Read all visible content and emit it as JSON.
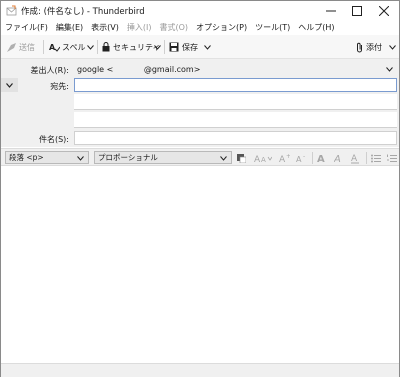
{
  "window": {
    "title": "作成: (件名なし) - Thunderbird"
  },
  "menubar": {
    "items": [
      "ファイル(F)",
      "編集(E)",
      "表示(V)",
      "挿入(I)",
      "書式(O)",
      "オプション(P)",
      "ツール(T)",
      "ヘルプ(H)"
    ]
  },
  "toolbar": {
    "send_label": "送信",
    "spell_label": "スペル",
    "security_label": "セキュリティ",
    "save_label": "保存",
    "attach_label": "添付"
  },
  "compose": {
    "from_label": "差出人(R):",
    "from_value": "google <            @gmail.com>",
    "to_label": "宛先:",
    "to_value": "",
    "subject_label": "件名(S):",
    "subject_value": ""
  },
  "format": {
    "paragraph_value": "段落 <p>",
    "font_value": "プロポーショナル"
  },
  "icons": {
    "app": "thunderbird-compose-icon",
    "send": "send-icon",
    "spell": "spell-check-icon",
    "security": "lock-icon",
    "save": "save-icon",
    "attach": "paperclip-icon"
  }
}
